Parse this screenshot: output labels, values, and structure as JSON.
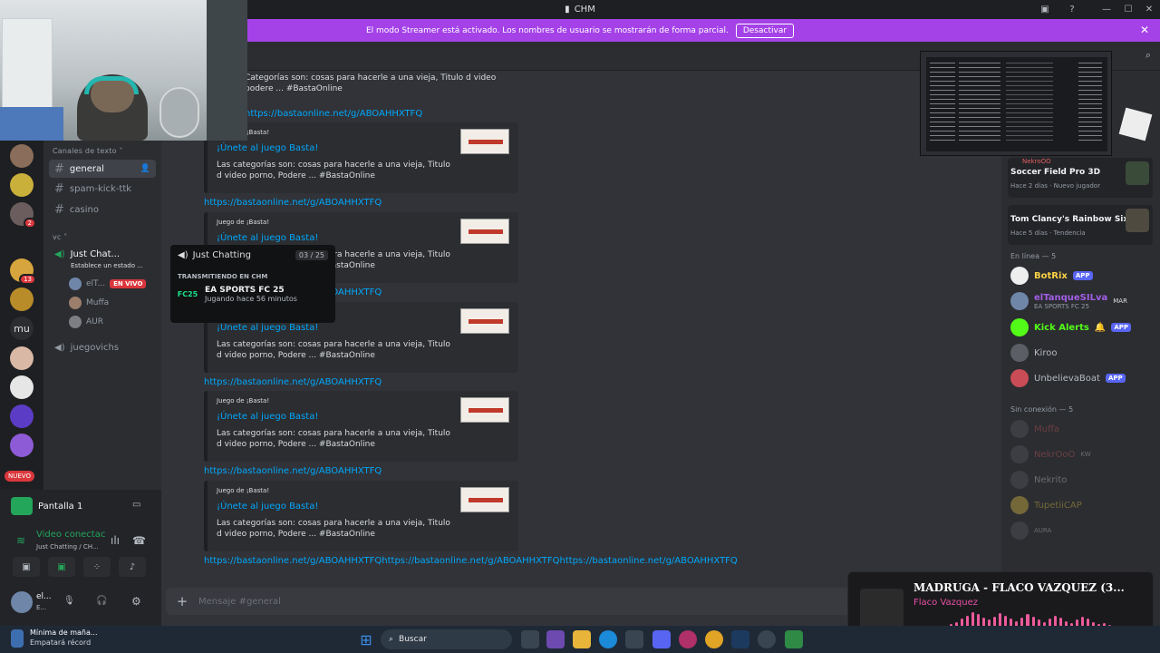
{
  "window": {
    "title": "CHM",
    "minimize": "—",
    "maximize": "☐",
    "close": "✕"
  },
  "banner": {
    "text": "El modo Streamer está activado. Los nombres de usuario se mostrarán de forma parcial.",
    "button": "Desactivar",
    "close": "✕"
  },
  "guild_badges": {
    "g3": "2",
    "g5": "13",
    "nuevo": "NUEVO",
    "g_mu": "mu"
  },
  "channels": {
    "text_category": "Canales de texto",
    "text": [
      {
        "label": "general"
      },
      {
        "label": "spam-kick-ttk"
      },
      {
        "label": "casino"
      }
    ],
    "vc_category": "vc",
    "voice_channel": "Just Chat...",
    "voice_status": "Establece un estado ...",
    "voice_users": [
      {
        "name": "elT...",
        "live": "EN VIVO"
      },
      {
        "name": "Muffa"
      },
      {
        "name": "AUR"
      }
    ],
    "juegovichs": "juegovichs"
  },
  "popup": {
    "title": "Just Chatting",
    "count": "03 / 25",
    "label": "TRANSMITIENDO EN CHM",
    "game": "EA SPORTS FC 25",
    "game_sub": "Jugando hace 56 minutos",
    "game_icon": "FC25"
  },
  "panel": {
    "screen": "Pantalla 1",
    "voice_status": "Video conectac",
    "voice_sub": "Just Chatting / CH...",
    "user": "el...",
    "user_sub": "E..."
  },
  "messages": {
    "top_desc": [
      "Categorías son: cosas para hacerle a una vieja, Titulo d video",
      "podere ... #BastaOnline"
    ],
    "link": "https://bastaonline.net/g/ABOAHHXTFQ",
    "embed_provider": "Juego de ¡Basta!",
    "embed_title": "¡Únete al juego Basta!",
    "embed_desc": "Las categorías son: cosas para hacerle a una vieja, Titulo d video porno, Podere ... #BastaOnline",
    "last_link": "https://bastaonline.net/g/ABOAHHXTFQhttps://bastaonline.net/g/ABOAHHXTFQhttps://bastaonline.net/g/ABOAHHXTFQ",
    "input_placeholder": "Mensaje #general",
    "plus": "+"
  },
  "activities": [
    {
      "name": "Soccer Field Pro 3D",
      "top": "NekroOO",
      "sub": "Hace 2 días · Nuevo jugador"
    },
    {
      "name": "Tom Clancy's Rainbow Six ...",
      "sub": "Hace 5 días · Tendencia"
    }
  ],
  "members": {
    "online_header": "En línea — 5",
    "online": [
      {
        "name": "BotRix",
        "tag": "APP",
        "color": "#fbd245"
      },
      {
        "name": "elTanqueSILva",
        "tag": "MAR",
        "sub": "EA SPORTS FC 25",
        "color": "#a35ee6"
      },
      {
        "name": "Kick Alerts",
        "tag": "APP",
        "color": "#53fc18"
      },
      {
        "name": "Kiroo",
        "color": "#b5bac1"
      },
      {
        "name": "UnbelievaBoat",
        "tag": "APP",
        "color": "#b5bac1"
      }
    ],
    "offline_header": "Sin conexión — 5",
    "offline": [
      {
        "name": "Muffa"
      },
      {
        "name": "NekrOoO",
        "tag": "KW"
      },
      {
        "name": "Nekrito"
      },
      {
        "name": "TupetiiCAP"
      },
      {
        "name": "AURA"
      }
    ]
  },
  "music": {
    "song": "MADRUGA - FLACO VAZQUEZ (3...",
    "artist": "Flaco Vazquez",
    "levels": [
      0.3,
      0.45,
      0.55,
      0.7,
      0.85,
      1,
      0.9,
      0.75,
      0.65,
      0.8,
      0.95,
      0.85,
      0.7,
      0.6,
      0.75,
      0.9,
      0.8,
      0.65,
      0.55,
      0.7,
      0.85,
      0.75,
      0.6,
      0.5,
      0.65,
      0.8,
      0.7,
      0.55,
      0.45,
      0.5,
      0.4,
      0.35
    ]
  },
  "taskbar": {
    "weather": "Mínima de maña...",
    "weather_sub": "Empatará récord",
    "search": "Buscar"
  }
}
